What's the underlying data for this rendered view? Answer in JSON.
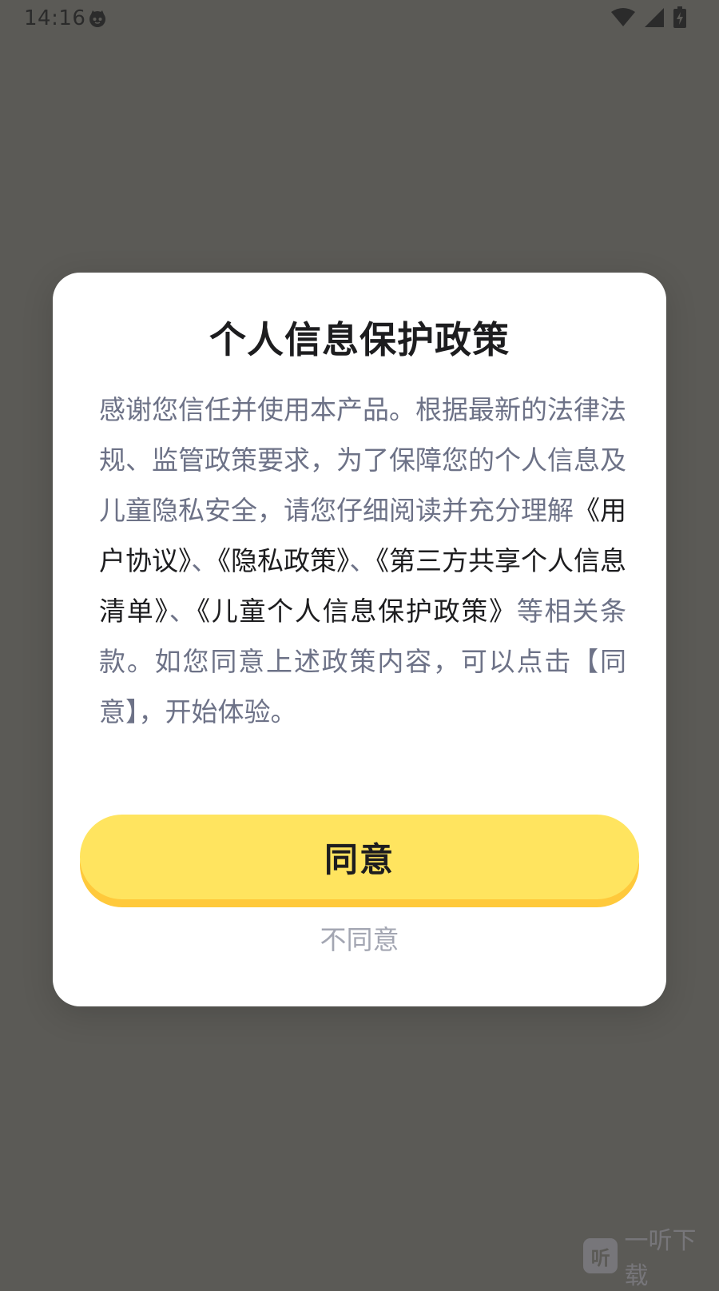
{
  "status_bar": {
    "time": "14:16",
    "icons": [
      "cat-notification-icon",
      "wifi-icon",
      "cellular-signal-icon",
      "battery-charging-icon"
    ]
  },
  "dialog": {
    "title": "个人信息保护政策",
    "body": {
      "intro": "感谢您信任并使用本产品。根据最新的法律法规、监管政策要求，为了保障您的个人信息及儿童隐私安全，请您仔细阅读并充分理解",
      "link_user_agreement": "《用户协议》",
      "sep1": "、",
      "link_privacy_policy": "《隐私政策》",
      "sep2": "、",
      "link_third_party_list": "《第三方共享个人信息清单》",
      "sep3": "、",
      "link_child_policy": "《儿童个人信息保护政策》",
      "outro": "等相关条款。如您同意上述政策内容，可以点击【同意】，开始体验。"
    },
    "agree_label": "同意",
    "disagree_label": "不同意"
  },
  "watermark": {
    "logo_char": "听",
    "text": "一听下载"
  },
  "colors": {
    "overlay": "#5b5a56",
    "dialog_bg": "#ffffff",
    "button_yellow": "#ffe45f",
    "button_shadow": "#ffc93b",
    "body_text": "#6d7287",
    "link_text": "#1d1d1f",
    "muted_text": "#a3a6b2"
  }
}
